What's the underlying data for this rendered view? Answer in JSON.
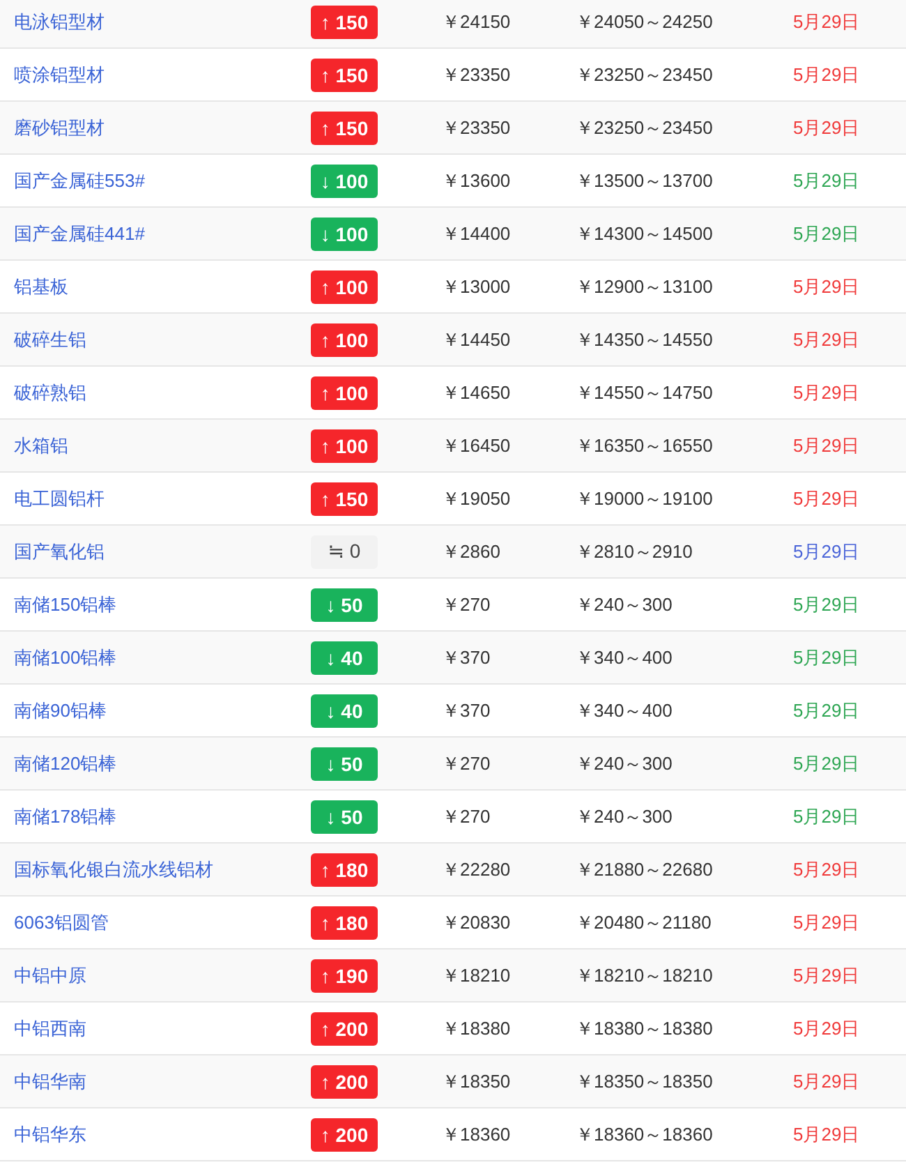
{
  "rows": [
    {
      "name": "电泳铝型材",
      "kind": "up",
      "arrow": "↑",
      "change": "150",
      "price": "￥24150",
      "range": "￥24050～24250",
      "date": "5月29日"
    },
    {
      "name": "喷涂铝型材",
      "kind": "up",
      "arrow": "↑",
      "change": "150",
      "price": "￥23350",
      "range": "￥23250～23450",
      "date": "5月29日"
    },
    {
      "name": "磨砂铝型材",
      "kind": "up",
      "arrow": "↑",
      "change": "150",
      "price": "￥23350",
      "range": "￥23250～23450",
      "date": "5月29日"
    },
    {
      "name": "国产金属硅553#",
      "kind": "down",
      "arrow": "↓",
      "change": "100",
      "price": "￥13600",
      "range": "￥13500～13700",
      "date": "5月29日"
    },
    {
      "name": "国产金属硅441#",
      "kind": "down",
      "arrow": "↓",
      "change": "100",
      "price": "￥14400",
      "range": "￥14300～14500",
      "date": "5月29日"
    },
    {
      "name": "铝基板",
      "kind": "up",
      "arrow": "↑",
      "change": "100",
      "price": "￥13000",
      "range": "￥12900～13100",
      "date": "5月29日"
    },
    {
      "name": "破碎生铝",
      "kind": "up",
      "arrow": "↑",
      "change": "100",
      "price": "￥14450",
      "range": "￥14350～14550",
      "date": "5月29日"
    },
    {
      "name": "破碎熟铝",
      "kind": "up",
      "arrow": "↑",
      "change": "100",
      "price": "￥14650",
      "range": "￥14550～14750",
      "date": "5月29日"
    },
    {
      "name": "水箱铝",
      "kind": "up",
      "arrow": "↑",
      "change": "100",
      "price": "￥16450",
      "range": "￥16350～16550",
      "date": "5月29日"
    },
    {
      "name": "电工圆铝杆",
      "kind": "up",
      "arrow": "↑",
      "change": "150",
      "price": "￥19050",
      "range": "￥19000～19100",
      "date": "5月29日"
    },
    {
      "name": "国产氧化铝",
      "kind": "flat",
      "arrow": "≒",
      "change": "0",
      "price": "￥2860",
      "range": "￥2810～2910",
      "date": "5月29日"
    },
    {
      "name": "南储150铝棒",
      "kind": "down",
      "arrow": "↓",
      "change": "50",
      "price": "￥270",
      "range": "￥240～300",
      "date": "5月29日"
    },
    {
      "name": "南储100铝棒",
      "kind": "down",
      "arrow": "↓",
      "change": "40",
      "price": "￥370",
      "range": "￥340～400",
      "date": "5月29日"
    },
    {
      "name": "南储90铝棒",
      "kind": "down",
      "arrow": "↓",
      "change": "40",
      "price": "￥370",
      "range": "￥340～400",
      "date": "5月29日"
    },
    {
      "name": "南储120铝棒",
      "kind": "down",
      "arrow": "↓",
      "change": "50",
      "price": "￥270",
      "range": "￥240～300",
      "date": "5月29日"
    },
    {
      "name": "南储178铝棒",
      "kind": "down",
      "arrow": "↓",
      "change": "50",
      "price": "￥270",
      "range": "￥240～300",
      "date": "5月29日"
    },
    {
      "name": "国标氧化银白流水线铝材",
      "kind": "up",
      "arrow": "↑",
      "change": "180",
      "price": "￥22280",
      "range": "￥21880～22680",
      "date": "5月29日"
    },
    {
      "name": "6063铝圆管",
      "kind": "up",
      "arrow": "↑",
      "change": "180",
      "price": "￥20830",
      "range": "￥20480～21180",
      "date": "5月29日"
    },
    {
      "name": "中铝中原",
      "kind": "up",
      "arrow": "↑",
      "change": "190",
      "price": "￥18210",
      "range": "￥18210～18210",
      "date": "5月29日"
    },
    {
      "name": "中铝西南",
      "kind": "up",
      "arrow": "↑",
      "change": "200",
      "price": "￥18380",
      "range": "￥18380～18380",
      "date": "5月29日"
    },
    {
      "name": "中铝华南",
      "kind": "up",
      "arrow": "↑",
      "change": "200",
      "price": "￥18350",
      "range": "￥18350～18350",
      "date": "5月29日"
    },
    {
      "name": "中铝华东",
      "kind": "up",
      "arrow": "↑",
      "change": "200",
      "price": "￥18360",
      "range": "￥18360～18360",
      "date": "5月29日"
    }
  ]
}
